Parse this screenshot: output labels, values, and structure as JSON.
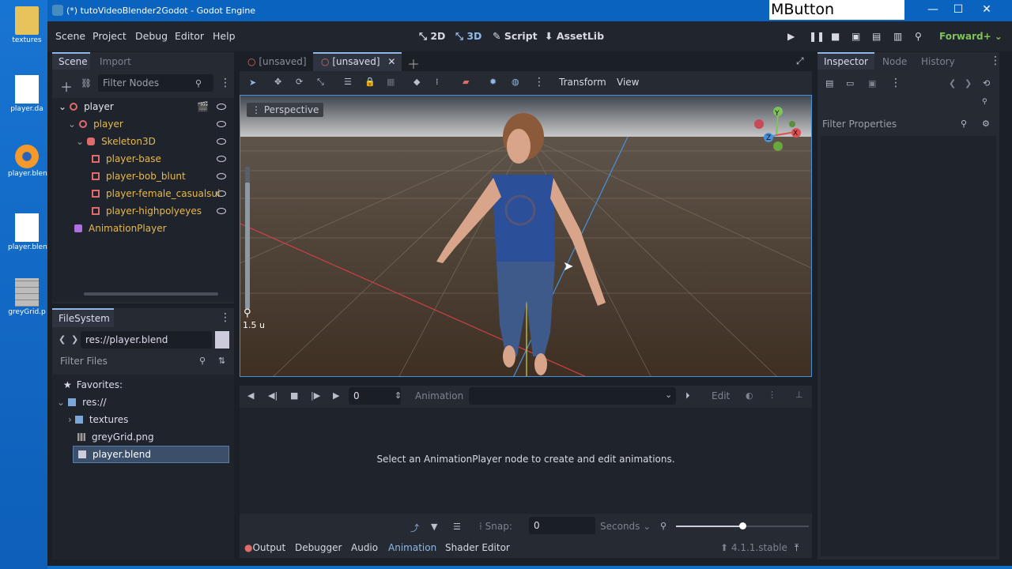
{
  "window": {
    "title": "(*) tutoVideoBlender2Godot - Godot Engine",
    "overlay": "MButton"
  },
  "desktop": {
    "items": [
      {
        "label": "textures"
      },
      {
        "label": "player.da"
      },
      {
        "label": "player.blen"
      },
      {
        "label": "player.blen"
      },
      {
        "label": "greyGrid.p"
      }
    ]
  },
  "menu": {
    "scene": "Scene",
    "project": "Project",
    "debug": "Debug",
    "editor": "Editor",
    "help": "Help"
  },
  "workspaces": {
    "w2d": "2D",
    "w3d": "3D",
    "script": "Script",
    "assetlib": "AssetLib"
  },
  "renderer": "Forward+",
  "scene_dock": {
    "tab_scene": "Scene",
    "tab_import": "Import",
    "filter_placeholder": "Filter Nodes",
    "nodes": [
      {
        "label": "player"
      },
      {
        "label": "player"
      },
      {
        "label": "Skeleton3D"
      },
      {
        "label": "player-base"
      },
      {
        "label": "player-bob_blunt"
      },
      {
        "label": "player-female_casualsuit"
      },
      {
        "label": "player-highpolyeyes"
      },
      {
        "label": "AnimationPlayer"
      }
    ]
  },
  "filesystem": {
    "tab": "FileSystem",
    "path": "res://player.blend",
    "filter_placeholder": "Filter Files",
    "favorites": "Favorites:",
    "root": "res://",
    "items": [
      {
        "label": "textures"
      },
      {
        "label": "greyGrid.png"
      },
      {
        "label": "player.blend"
      }
    ]
  },
  "editor_tabs": [
    {
      "label": "[unsaved]"
    },
    {
      "label": "[unsaved]"
    }
  ],
  "toolbar": {
    "transform": "Transform",
    "view": "View"
  },
  "viewport": {
    "perspective": "Perspective",
    "zoom": "1.5 u",
    "gizmo": {
      "x": "X",
      "y": "Y",
      "z": "Z"
    }
  },
  "animation": {
    "time": "0",
    "label": "Animation",
    "edit": "Edit",
    "message": "Select an AnimationPlayer node to create and edit animations.",
    "snap_label": "Snap:",
    "snap": "0",
    "seconds": "Seconds"
  },
  "bottom_tabs": {
    "output": "Output",
    "debugger": "Debugger",
    "audio": "Audio",
    "animation": "Animation",
    "shader": "Shader Editor",
    "version": "4.1.1.stable"
  },
  "inspector": {
    "tab": "Inspector",
    "node": "Node",
    "history": "History",
    "filter_placeholder": "Filter Properties"
  },
  "colors": {
    "accent": "#8fb8e8",
    "node_text": "#e8b84a",
    "title": "#0b63c0"
  }
}
